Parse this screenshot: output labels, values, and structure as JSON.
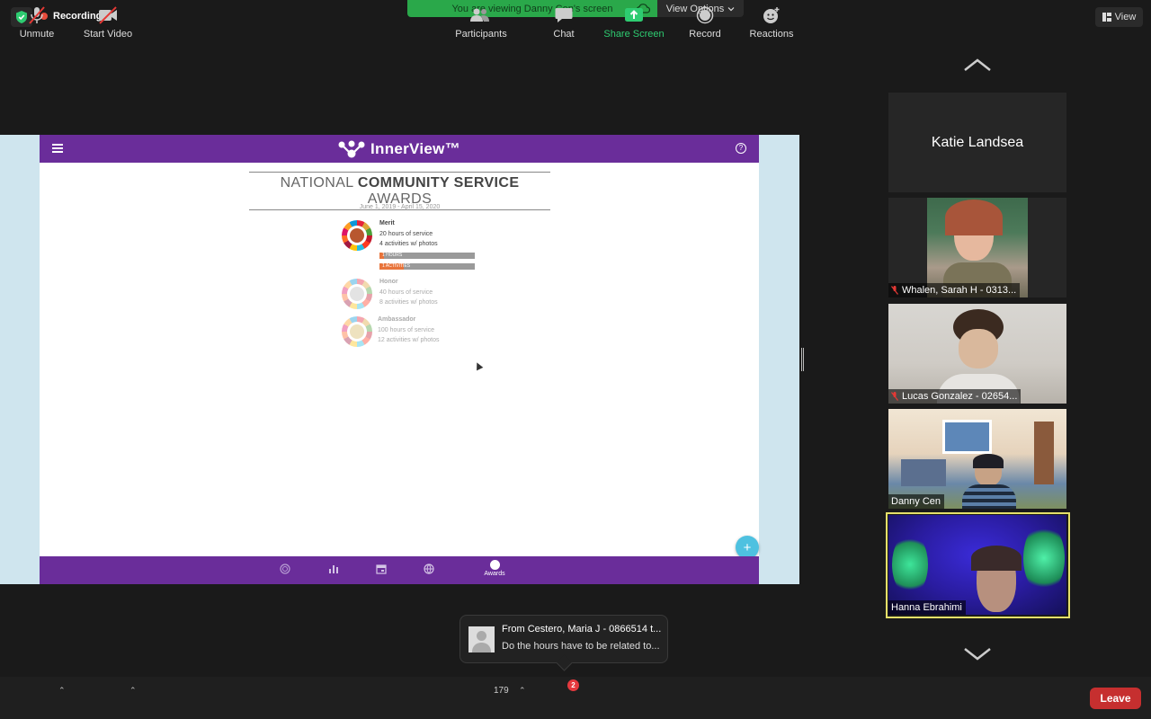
{
  "top": {
    "recording_label": "Recording",
    "viewing_banner": "You are viewing Danny Cen's screen",
    "view_options_label": "View Options",
    "view_label": "View",
    "colors": {
      "banner": "#2aa84a",
      "record_dot": "#e74c3c"
    }
  },
  "shared_app": {
    "logo_text": "InnerView™",
    "title_regular_1": "NATIONAL",
    "title_bold": "COMMUNITY SERVICE",
    "title_regular_2": "AWARDS",
    "date_range": "June 1, 2019 - April 15, 2020",
    "levels": [
      {
        "name": "Merit",
        "hours": "20 hours of service",
        "activities": "4 activities w/ photos",
        "hours_bar": "1 HOURS",
        "activities_bar": "1 ACTIVITIES",
        "hours_progress": 0.05,
        "activities_progress": 0.25
      },
      {
        "name": "Honor",
        "hours": "40 hours of service",
        "activities": "8 activities w/ photos"
      },
      {
        "name": "Ambassador",
        "hours": "100 hours of service",
        "activities": "12 activities w/ photos"
      }
    ],
    "fab_label": "+",
    "footer_active_label": "Awards",
    "colors": {
      "brand": "#6a2d9a",
      "progress": "#e8743b",
      "fab": "#4ec1e0"
    }
  },
  "participants_tiles": [
    {
      "name": "Katie Landsea",
      "muted": false,
      "video": false
    },
    {
      "name": "Whalen, Sarah H - 0313...",
      "muted": true,
      "video": true
    },
    {
      "name": "Lucas Gonzalez - 02654...",
      "muted": true,
      "video": true
    },
    {
      "name": "Danny Cen",
      "muted": false,
      "video": true
    },
    {
      "name": "Hanna Ebrahimi",
      "muted": false,
      "video": true,
      "active_speaker": true
    }
  ],
  "chat_popup": {
    "from": "From Cestero, Maria J - 0866514 t...",
    "message": "Do the hours have to be related to..."
  },
  "toolbar": {
    "unmute": "Unmute",
    "start_video": "Start Video",
    "participants": "Participants",
    "participants_count": "179",
    "chat": "Chat",
    "chat_badge": "2",
    "share_screen": "Share Screen",
    "record": "Record",
    "reactions": "Reactions",
    "leave": "Leave",
    "colors": {
      "share": "#2ecc71",
      "leave": "#c62f2f"
    }
  }
}
